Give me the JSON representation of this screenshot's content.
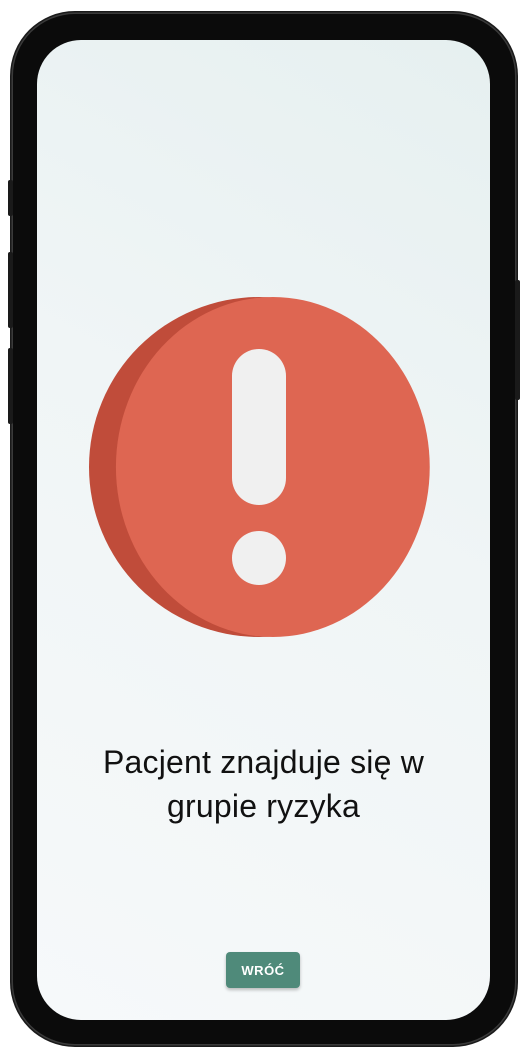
{
  "screen": {
    "message_line1": "Pacjent znajduje się w",
    "message_line2": "grupie ryzyka",
    "back_button_label": "WRÓĆ",
    "icon": "exclamation-alert-icon"
  },
  "colors": {
    "alert_circle": "#de6652",
    "alert_circle_shadow": "#c04c3a",
    "exclamation_mark": "#f0f0f0",
    "button_background": "#4f8a7a",
    "button_text": "#ffffff"
  }
}
